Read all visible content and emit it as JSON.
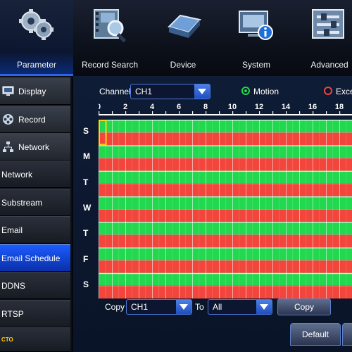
{
  "top_nav": {
    "items": [
      {
        "label": "Parameter",
        "icon": "gears-icon",
        "active": true
      },
      {
        "label": "Record Search",
        "icon": "film-search-icon",
        "active": false
      },
      {
        "label": "Device",
        "icon": "hard-drive-icon",
        "active": false
      },
      {
        "label": "System",
        "icon": "system-info-icon",
        "active": false
      },
      {
        "label": "Advanced",
        "icon": "sliders-icon",
        "active": false
      }
    ]
  },
  "sidebar": {
    "items": [
      {
        "label": "Display",
        "group": true,
        "icon": "monitor-icon"
      },
      {
        "label": "Record",
        "group": true,
        "icon": "film-reel-icon"
      },
      {
        "label": "Network",
        "group": true,
        "icon": "network-icon"
      },
      {
        "label": "Network",
        "group": false
      },
      {
        "label": "Substream",
        "group": false
      },
      {
        "label": "Email",
        "group": false
      },
      {
        "label": "Email Schedule",
        "group": false,
        "selected": true
      },
      {
        "label": "DDNS",
        "group": false
      },
      {
        "label": "RTSP",
        "group": false
      },
      {
        "label": "CTO",
        "group": false
      }
    ]
  },
  "main": {
    "channel_label": "Channel",
    "channel_value": "CH1",
    "motion_label": "Motion",
    "exception_label": "Exce",
    "hour_ticks": [
      "0",
      "2",
      "4",
      "6",
      "8",
      "10",
      "12",
      "14",
      "16",
      "18"
    ],
    "days": [
      "S",
      "M",
      "T",
      "W",
      "T",
      "F",
      "S"
    ],
    "copy_label": "Copy",
    "copy_from_value": "CH1",
    "to_label": "To",
    "copy_to_value": "All",
    "copy_button": "Copy",
    "default_button": "Default"
  },
  "colors": {
    "motion_green": "#22d84e",
    "exception_red": "#f2453c",
    "accent_blue": "#2d63e8",
    "selection_yellow": "#ffd21a"
  }
}
